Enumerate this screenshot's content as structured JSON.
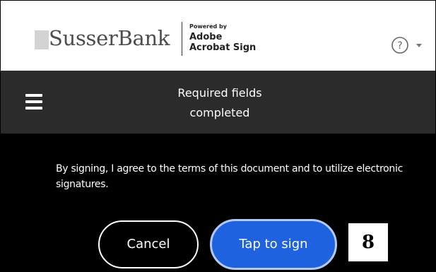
{
  "header": {
    "brand_name": "SusserBank",
    "powered_by": "Powered by",
    "adobe": "Adobe",
    "acrobat_sign": "Acrobat Sign",
    "help_icon": "question-circle-icon",
    "help_glyph": "?"
  },
  "status": {
    "menu_icon": "hamburger-menu-icon",
    "line1": "Required fields",
    "line2": "completed"
  },
  "consent": {
    "text": "By signing, I agree to the terms of this document and to utilize electronic signatures."
  },
  "actions": {
    "cancel_label": "Cancel",
    "sign_label": "Tap to sign"
  },
  "annotation": {
    "step_number": "8"
  },
  "colors": {
    "status_bar": "#2b2b2b",
    "body_background": "#000000",
    "sign_button": "#1e62e0",
    "sign_button_border": "#b5c9f7"
  }
}
